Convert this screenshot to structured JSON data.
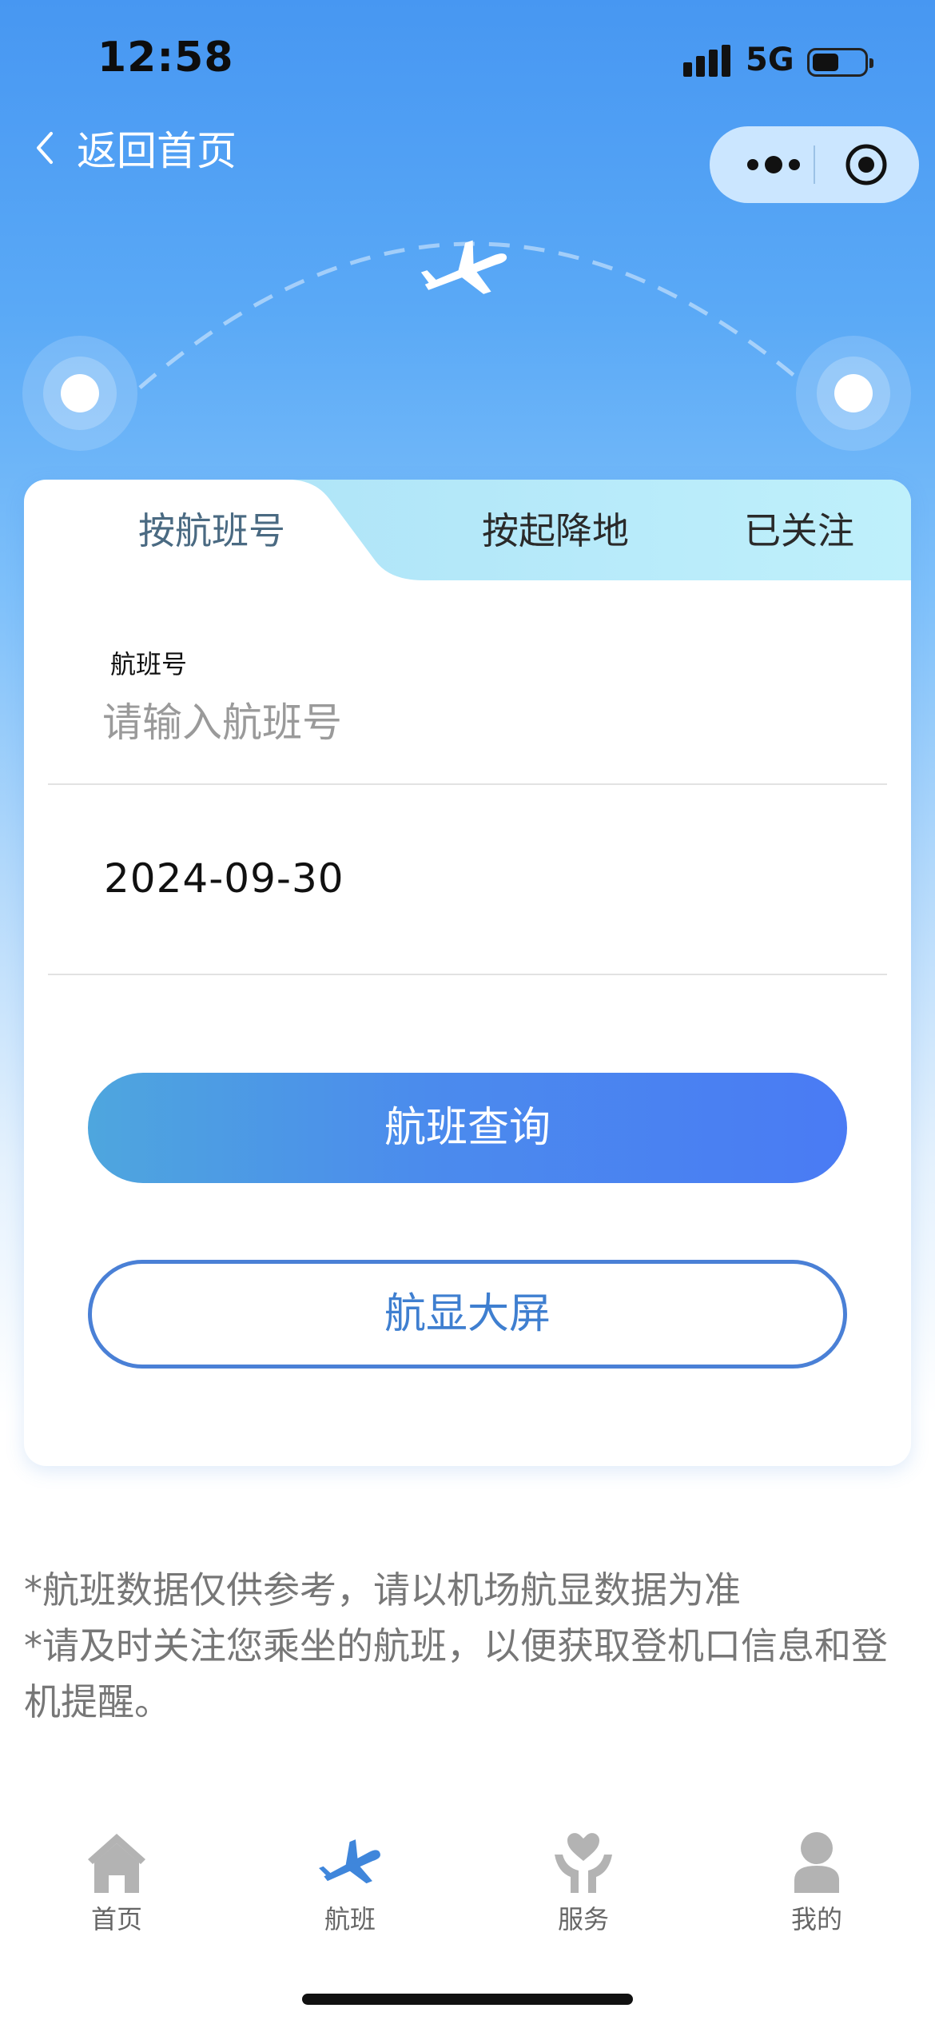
{
  "status_bar": {
    "time": "12:58",
    "network": "5G"
  },
  "nav": {
    "back_label": "返回首页"
  },
  "tabs": [
    {
      "label": "按航班号",
      "active": true
    },
    {
      "label": "按起降地",
      "active": false
    },
    {
      "label": "已关注",
      "active": false
    }
  ],
  "form": {
    "flight_label": "航班号",
    "flight_placeholder": "请输入航班号",
    "flight_value": "",
    "date_value": "2024-09-30"
  },
  "buttons": {
    "search": "航班查询",
    "big_screen": "航显大屏"
  },
  "notes": [
    "*航班数据仅供参考，请以机场航显数据为准",
    "*请及时关注您乘坐的航班，以便获取登机口信息和登机提醒。"
  ],
  "tabbar": [
    {
      "label": "首页",
      "icon": "home-icon",
      "active": false
    },
    {
      "label": "航班",
      "icon": "airplane-icon",
      "active": true
    },
    {
      "label": "服务",
      "icon": "service-icon",
      "active": false
    },
    {
      "label": "我的",
      "icon": "profile-icon",
      "active": false
    }
  ],
  "colors": {
    "accent": "#4a80d6",
    "header_blue": "#4797f2",
    "tab_strip": "#b4e8f9",
    "primary_button_start": "#4ea6de",
    "primary_button_end": "#4a7bf4",
    "note_text": "#777777",
    "inactive_tab_icon": "#b3b3b3"
  }
}
